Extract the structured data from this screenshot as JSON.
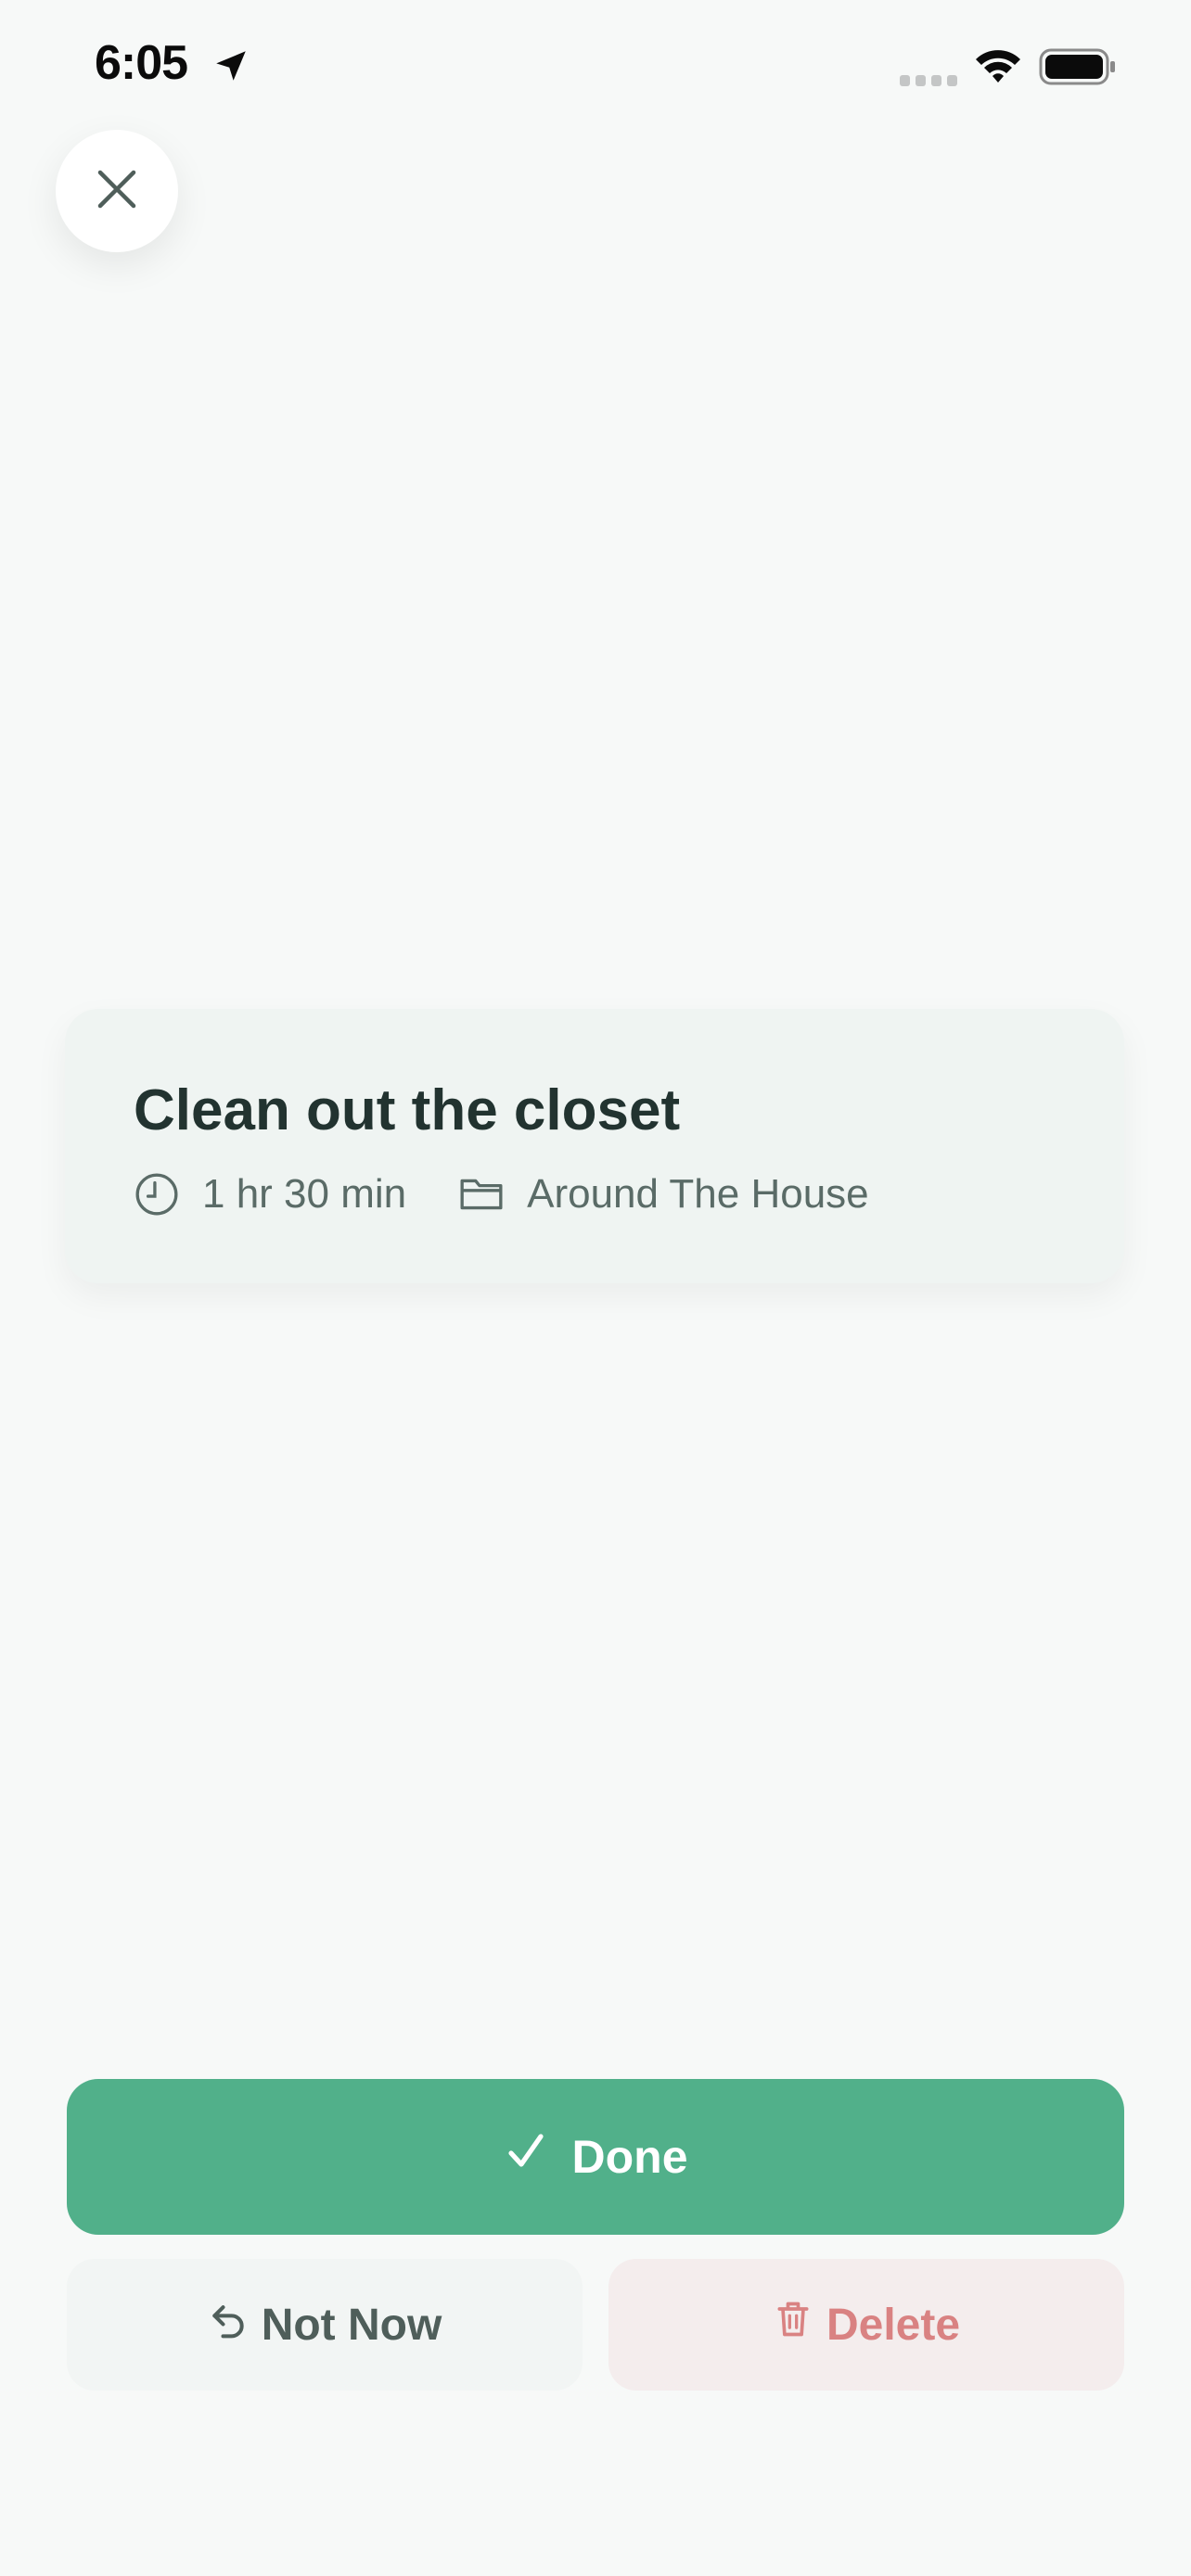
{
  "status_bar": {
    "time": "6:05",
    "location_icon": "location-arrow-icon",
    "signal_icon": "cellular-signal-icon",
    "wifi_icon": "wifi-icon",
    "battery_icon": "battery-icon"
  },
  "close_button": {
    "icon": "close-icon"
  },
  "task": {
    "title": "Clean out the closet",
    "duration": "1 hr 30 min",
    "duration_icon": "clock-icon",
    "category": "Around The House",
    "category_icon": "folder-icon"
  },
  "actions": {
    "done_label": "Done",
    "done_icon": "checkmark-icon",
    "not_now_label": "Not Now",
    "not_now_icon": "undo-arrow-icon",
    "delete_label": "Delete",
    "delete_icon": "trash-icon"
  },
  "colors": {
    "background": "#f7f9f8",
    "done": "#51b08a",
    "not_now_bg": "#f2f5f4",
    "delete_bg": "#f4eded",
    "delete_text": "#d98282",
    "title_text": "#223330",
    "meta_text": "#5a6b67"
  }
}
